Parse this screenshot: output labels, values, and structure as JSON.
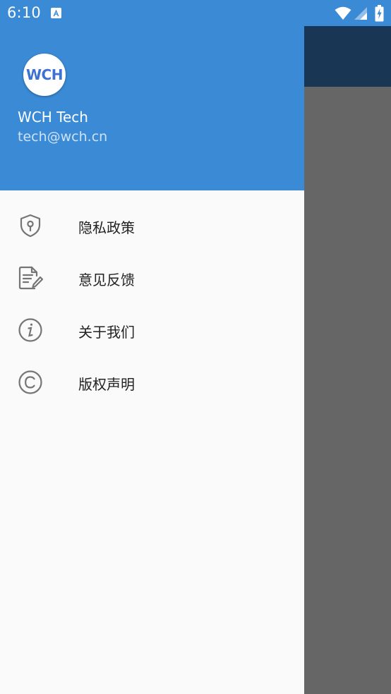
{
  "status_bar": {
    "time": "6:10",
    "icons": [
      "a-notification-icon",
      "wifi-icon",
      "signal-icon",
      "battery-charging-icon"
    ]
  },
  "drawer": {
    "header": {
      "avatar_text": "WCH",
      "user_name": "WCH Tech",
      "user_email": "tech@wch.cn"
    },
    "items": [
      {
        "label": "隐私政策",
        "icon": "shield-keyhole-icon"
      },
      {
        "label": "意见反馈",
        "icon": "feedback-document-edit-icon"
      },
      {
        "label": "关于我们",
        "icon": "info-icon"
      },
      {
        "label": "版权声明",
        "icon": "copyright-icon"
      }
    ]
  },
  "colors": {
    "header_blue": "#3a8ad6",
    "toolbar_dim": "#193755",
    "scrim_gray": "#666666",
    "drawer_bg": "#fafafa",
    "icon_gray": "#757575"
  }
}
